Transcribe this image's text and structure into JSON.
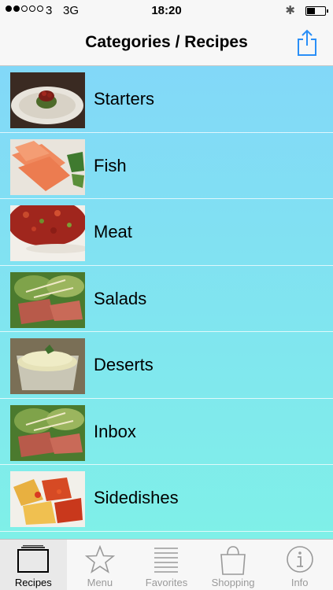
{
  "status_bar": {
    "carrier": "3",
    "network": "3G",
    "time": "18:20",
    "bluetooth_glyph": "✱",
    "battery_level": 0.45
  },
  "nav": {
    "title": "Categories / Recipes",
    "share_icon": "share-icon",
    "accent": "#2a8ff7"
  },
  "categories": [
    {
      "label": "Starters",
      "icon": "starters-thumbnail"
    },
    {
      "label": "Fish",
      "icon": "fish-thumbnail"
    },
    {
      "label": "Meat",
      "icon": "meat-thumbnail"
    },
    {
      "label": "Salads",
      "icon": "salads-thumbnail"
    },
    {
      "label": "Deserts",
      "icon": "deserts-thumbnail"
    },
    {
      "label": "Inbox",
      "icon": "inbox-thumbnail"
    },
    {
      "label": "Sidedishes",
      "icon": "sidedishes-thumbnail"
    }
  ],
  "tabs": [
    {
      "label": "Recipes",
      "icon": "recipes-icon",
      "active": true
    },
    {
      "label": "Menu",
      "icon": "star-icon",
      "active": false
    },
    {
      "label": "Favorites",
      "icon": "list-icon",
      "active": false
    },
    {
      "label": "Shopping",
      "icon": "shopping-bag-icon",
      "active": false
    },
    {
      "label": "Info",
      "icon": "info-icon",
      "active": false
    }
  ],
  "colors": {
    "list_top": "#82d8f8",
    "list_bottom": "#7ff0e8",
    "tab_inactive": "#9a9a9a"
  }
}
